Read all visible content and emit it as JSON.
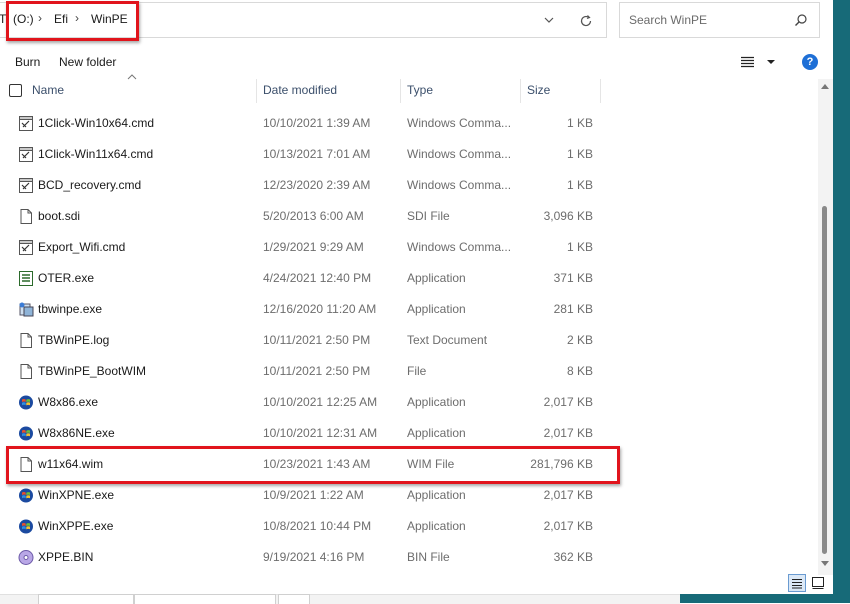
{
  "address_bar": {
    "crumbs": [
      "TI (O:)",
      "Efi",
      "WinPE"
    ]
  },
  "search": {
    "placeholder": "Search WinPE"
  },
  "command_bar": {
    "burn_label": "Burn",
    "new_folder_label": "New folder",
    "help_label": "?"
  },
  "columns": {
    "name": "Name",
    "date": "Date modified",
    "type": "Type",
    "size": "Size"
  },
  "files": [
    {
      "name": "1Click-Win10x64.cmd",
      "date": "10/10/2021 1:39 AM",
      "type": "Windows Comma...",
      "size": "1 KB",
      "icon": "cmd-script-icon"
    },
    {
      "name": "1Click-Win11x64.cmd",
      "date": "10/13/2021 7:01 AM",
      "type": "Windows Comma...",
      "size": "1 KB",
      "icon": "cmd-script-icon"
    },
    {
      "name": "BCD_recovery.cmd",
      "date": "12/23/2020 2:39 AM",
      "type": "Windows Comma...",
      "size": "1 KB",
      "icon": "cmd-script-icon"
    },
    {
      "name": "boot.sdi",
      "date": "5/20/2013 6:00 AM",
      "type": "SDI File",
      "size": "3,096 KB",
      "icon": "blank-file-icon"
    },
    {
      "name": "Export_Wifi.cmd",
      "date": "1/29/2021 9:29 AM",
      "type": "Windows Comma...",
      "size": "1 KB",
      "icon": "cmd-script-icon"
    },
    {
      "name": "OTER.exe",
      "date": "4/24/2021 12:40 PM",
      "type": "Application",
      "size": "371 KB",
      "icon": "app-list-icon"
    },
    {
      "name": "tbwinpe.exe",
      "date": "12/16/2020 11:20 AM",
      "type": "Application",
      "size": "281 KB",
      "icon": "installer-icon"
    },
    {
      "name": "TBWinPE.log",
      "date": "10/11/2021 2:50 PM",
      "type": "Text Document",
      "size": "2 KB",
      "icon": "text-file-icon"
    },
    {
      "name": "TBWinPE_BootWIM",
      "date": "10/11/2021 2:50 PM",
      "type": "File",
      "size": "8 KB",
      "icon": "blank-file-icon"
    },
    {
      "name": "W8x86.exe",
      "date": "10/10/2021 12:25 AM",
      "type": "Application",
      "size": "2,017 KB",
      "icon": "windows-orb-icon"
    },
    {
      "name": "W8x86NE.exe",
      "date": "10/10/2021 12:31 AM",
      "type": "Application",
      "size": "2,017 KB",
      "icon": "windows-orb-icon"
    },
    {
      "name": "w11x64.wim",
      "date": "10/23/2021 1:43 AM",
      "type": "WIM File",
      "size": "281,796 KB",
      "icon": "blank-file-icon"
    },
    {
      "name": "WinXPNE.exe",
      "date": "10/9/2021 1:22 AM",
      "type": "Application",
      "size": "2,017 KB",
      "icon": "windows-orb-icon"
    },
    {
      "name": "WinXPPE.exe",
      "date": "10/8/2021 10:44 PM",
      "type": "Application",
      "size": "2,017 KB",
      "icon": "windows-orb-icon"
    },
    {
      "name": "XPPE.BIN",
      "date": "9/19/2021 4:16 PM",
      "type": "BIN File",
      "size": "362 KB",
      "icon": "disc-icon"
    }
  ],
  "colors": {
    "highlight": "#e1141c",
    "accent": "#1e6fd6",
    "desktop": "#176a78"
  }
}
